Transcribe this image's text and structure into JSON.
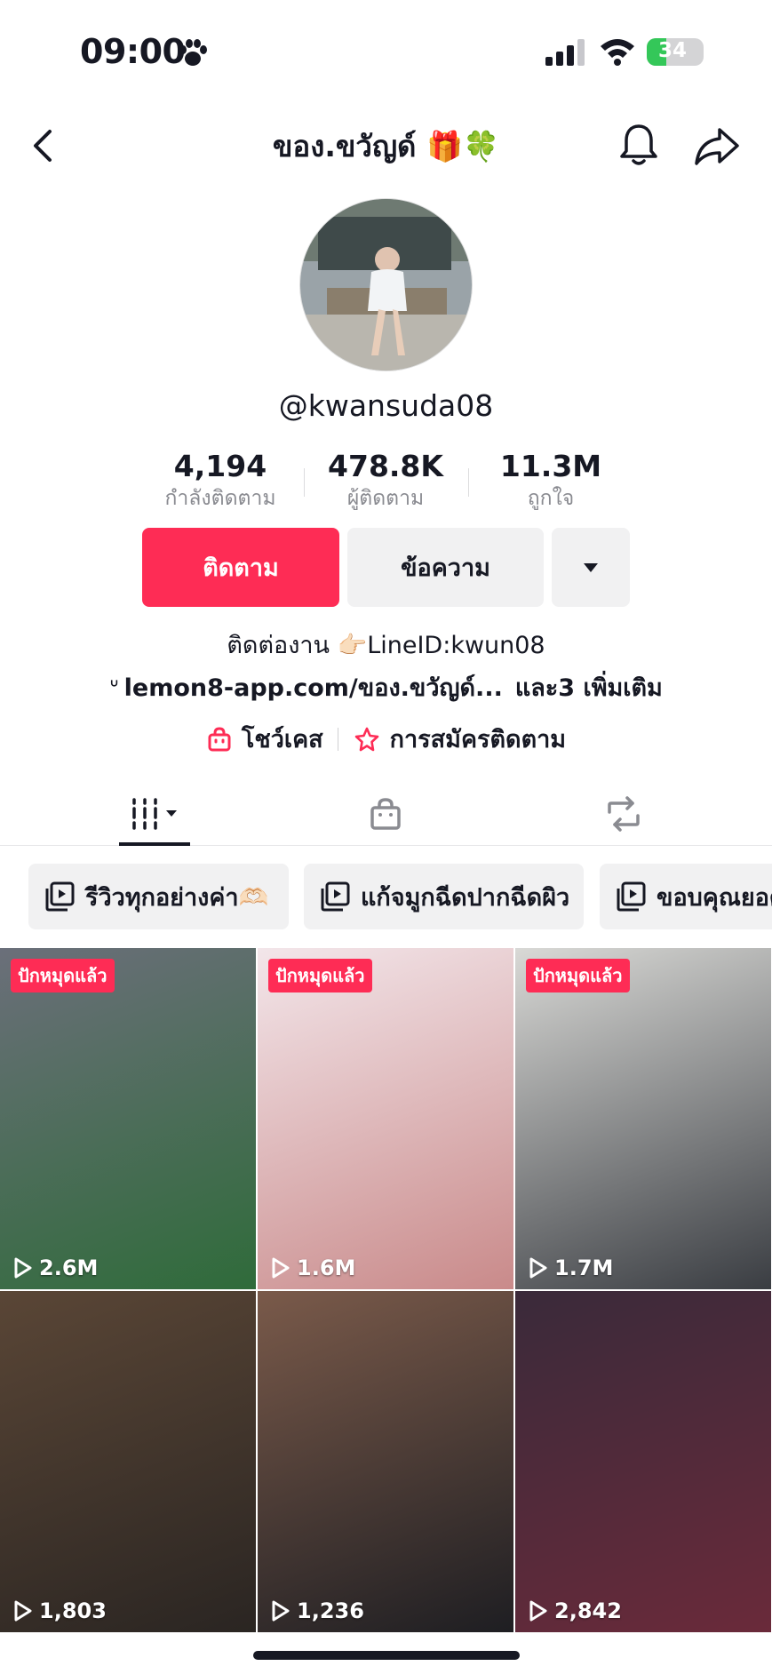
{
  "status_bar": {
    "time": "09:00",
    "battery": "34",
    "battery_level": 0.34
  },
  "nav": {
    "title": "ของ.ขวัญด์ 🎁🍀"
  },
  "profile": {
    "username": "@kwansuda08"
  },
  "stats": [
    {
      "value": "4,194",
      "label": "กำลังติดตาม"
    },
    {
      "value": "478.8K",
      "label": "ผู้ติดตาม"
    },
    {
      "value": "11.3M",
      "label": "ถูกใจ"
    }
  ],
  "buttons": {
    "follow": "ติดตาม",
    "message": "ข้อความ"
  },
  "bio": {
    "text": "ติดต่องาน 👉🏻LineID:kwun08",
    "link": "lemon8-app.com/ของ.ขวัญด์...",
    "link_more": "และ3 เพิ่มเติม"
  },
  "badges": {
    "showcase": "โชว์เคส",
    "subscription": "การสมัครติดตาม"
  },
  "playlists": [
    "รีวิวทุกอย่างค่า🫶🏻",
    "แก้จมูกฉีดปากฉีดผิว",
    "ขอบคุณยอด"
  ],
  "videos": [
    {
      "pinned": "ปักหมุดแล้ว",
      "views": "2.6M",
      "colors": [
        "#6b6f7a",
        "#2f6b3a"
      ]
    },
    {
      "pinned": "ปักหมุดแล้ว",
      "views": "1.6M",
      "colors": [
        "#f3e6ea",
        "#c98a8a"
      ]
    },
    {
      "pinned": "ปักหมุดแล้ว",
      "views": "1.7M",
      "colors": [
        "#d9d9d6",
        "#3a3d42"
      ]
    },
    {
      "pinned": "",
      "views": "1,803",
      "colors": [
        "#5a4636",
        "#2a2522"
      ]
    },
    {
      "pinned": "",
      "views": "1,236",
      "colors": [
        "#7a5a4a",
        "#1e1e22"
      ]
    },
    {
      "pinned": "",
      "views": "2,842",
      "colors": [
        "#3a2a3a",
        "#6a2a3a"
      ]
    }
  ],
  "colors": {
    "accent": "#fe2c55",
    "text": "#161823",
    "muted": "#8a8b91",
    "button_bg": "#f1f1f2"
  }
}
